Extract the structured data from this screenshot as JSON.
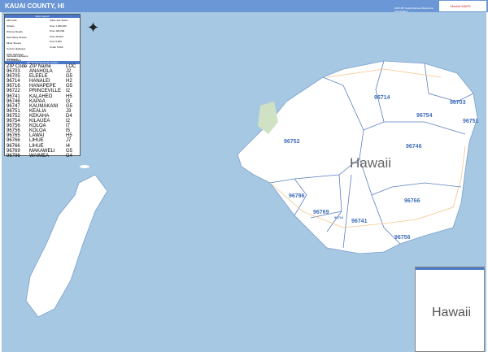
{
  "header": {
    "title": "KAUAI COUNTY, HI",
    "subtitle": "2025 ZIP Code Business Reference Inset Edition",
    "logo": "Market MAPS"
  },
  "legend": {
    "title": "Map Legend",
    "left_items": [
      "ZIP Code",
      "Streets",
      "Primary Roads",
      "Secondary Streets",
      "Minor Streets",
      "County Highways",
      "State Highways",
      "US Highways",
      "Interstate Highways",
      "Toll Roads"
    ],
    "right_items": [
      "Cities and Towns",
      "Over 1,000,000",
      "Over 100,000",
      "Over 25,000",
      "Over 5,000",
      "Under 5,000"
    ],
    "table_title": "ZIP Code Index/Grid Locator",
    "columns": [
      "ZIP Code",
      "ZIP Name",
      "LOC"
    ],
    "rows": [
      [
        "96703",
        "ANAHOLA",
        "J2"
      ],
      [
        "96705",
        "ELEELE",
        "G5"
      ],
      [
        "96714",
        "HANALEI",
        "H2"
      ],
      [
        "96716",
        "HANAPEPE",
        "G5"
      ],
      [
        "96722",
        "PRINCEVILLE",
        "I2"
      ],
      [
        "96741",
        "KALAHEO",
        "H5"
      ],
      [
        "96746",
        "KAPAA",
        "I3"
      ],
      [
        "96747",
        "KAUMAKANI",
        "G5"
      ],
      [
        "96751",
        "KEALIA",
        "J3"
      ],
      [
        "96752",
        "KEKAHA",
        "D4"
      ],
      [
        "96754",
        "KILAUEA",
        "I2"
      ],
      [
        "96756",
        "KOLOA",
        "I7"
      ],
      [
        "96756",
        "KOLOA",
        "I5"
      ],
      [
        "96765",
        "LAWAI",
        "H5"
      ],
      [
        "96766",
        "LIHUE",
        "J7"
      ],
      [
        "96766",
        "LIHUE",
        "I4"
      ],
      [
        "96769",
        "MAKAWELI",
        "G5"
      ],
      [
        "96796",
        "WAIMEA",
        "G4"
      ]
    ]
  },
  "map": {
    "island_label": "Hawaii",
    "zip_labels": [
      "96714",
      "96754",
      "96703",
      "96751",
      "96746",
      "96752",
      "96796",
      "96769",
      "96716",
      "96741",
      "96766",
      "96756"
    ],
    "inset_label": "Hawaii",
    "colors": {
      "water": "#a6c8e3",
      "land": "#ffffff",
      "boundary": "#5a7fc0",
      "header": "#6b97d6"
    }
  }
}
